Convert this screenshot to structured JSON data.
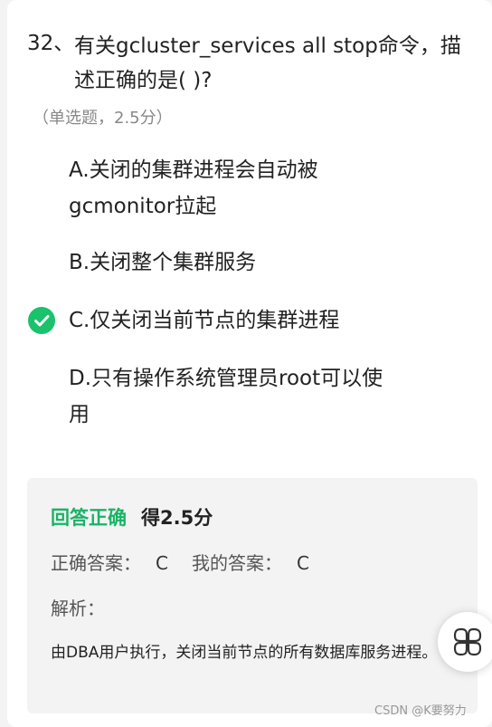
{
  "question": {
    "number": "32、",
    "text": "有关gcluster_services all stop命令，描述正确的是( )?",
    "meta": "（单选题，2.5分）"
  },
  "options": [
    {
      "label": "A.",
      "text": "关闭的集群进程会自动被gcmonitor拉起"
    },
    {
      "label": "B.",
      "text": "关闭整个集群服务"
    },
    {
      "label": "C.",
      "text": "仅关闭当前节点的集群进程"
    },
    {
      "label": "D.",
      "text": "只有操作系统管理员root可以使用"
    }
  ],
  "result": {
    "status": "回答正确",
    "score": "得2.5分",
    "correct_label": "正确答案：",
    "correct_value": "C",
    "mine_label": "我的答案：",
    "mine_value": "C",
    "analysis_label": "解析：",
    "analysis_text": "由DBA用户执行，关闭当前节点的所有数据库服务进程。"
  },
  "watermark": "CSDN @K要努力",
  "colors": {
    "accent_green": "#19c26b",
    "status_green": "#19b366"
  },
  "icons": {
    "selected_mark": "check-circle-icon",
    "floating_button": "grid-menu-icon"
  }
}
